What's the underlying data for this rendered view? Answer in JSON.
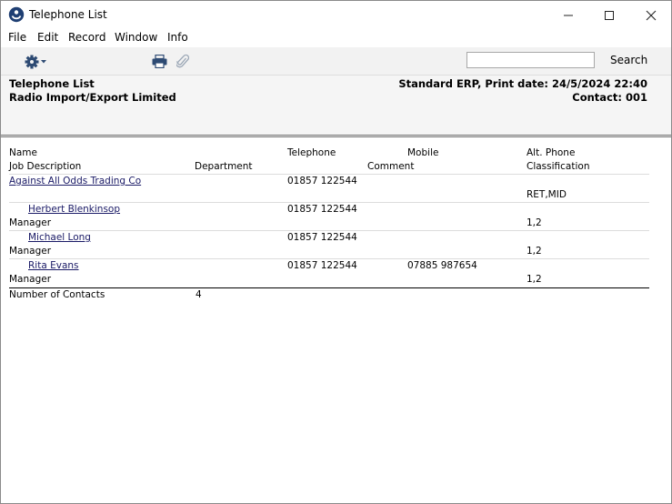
{
  "window": {
    "title": "Telephone List"
  },
  "menu": [
    "File",
    "Edit",
    "Record",
    "Window",
    "Info"
  ],
  "toolbar": {
    "search_label": "Search",
    "search_value": "",
    "gear_icon": "gear-icon",
    "print_icon": "printer-icon",
    "attach_icon": "paperclip-icon"
  },
  "header": {
    "title": "Telephone List",
    "company": "Radio Import/Export Limited",
    "system_info": "Standard ERP, Print date: 24/5/2024 22:40",
    "contact": "Contact: 001"
  },
  "columns": {
    "name": "Name",
    "telephone": "Telephone",
    "mobile": "Mobile",
    "alt_phone": "Alt. Phone",
    "job_description": "Job Description",
    "department": "Department",
    "comment": "Comment",
    "classification": "Classification"
  },
  "company_row": {
    "name": "Against All Odds Trading Co",
    "telephone": "01857 122544",
    "classification": "RET,MID"
  },
  "contacts": [
    {
      "name": "Herbert Blenkinsop",
      "telephone": "01857 122544",
      "mobile": "",
      "job": "Manager",
      "classification": "1,2"
    },
    {
      "name": "Michael Long",
      "telephone": "01857 122544",
      "mobile": "",
      "job": "Manager",
      "classification": "1,2"
    },
    {
      "name": "Rita Evans",
      "telephone": "01857 122544",
      "mobile": "07885 987654",
      "job": "Manager",
      "classification": "1,2"
    }
  ],
  "footer": {
    "label": "Number of Contacts",
    "count": "4"
  }
}
